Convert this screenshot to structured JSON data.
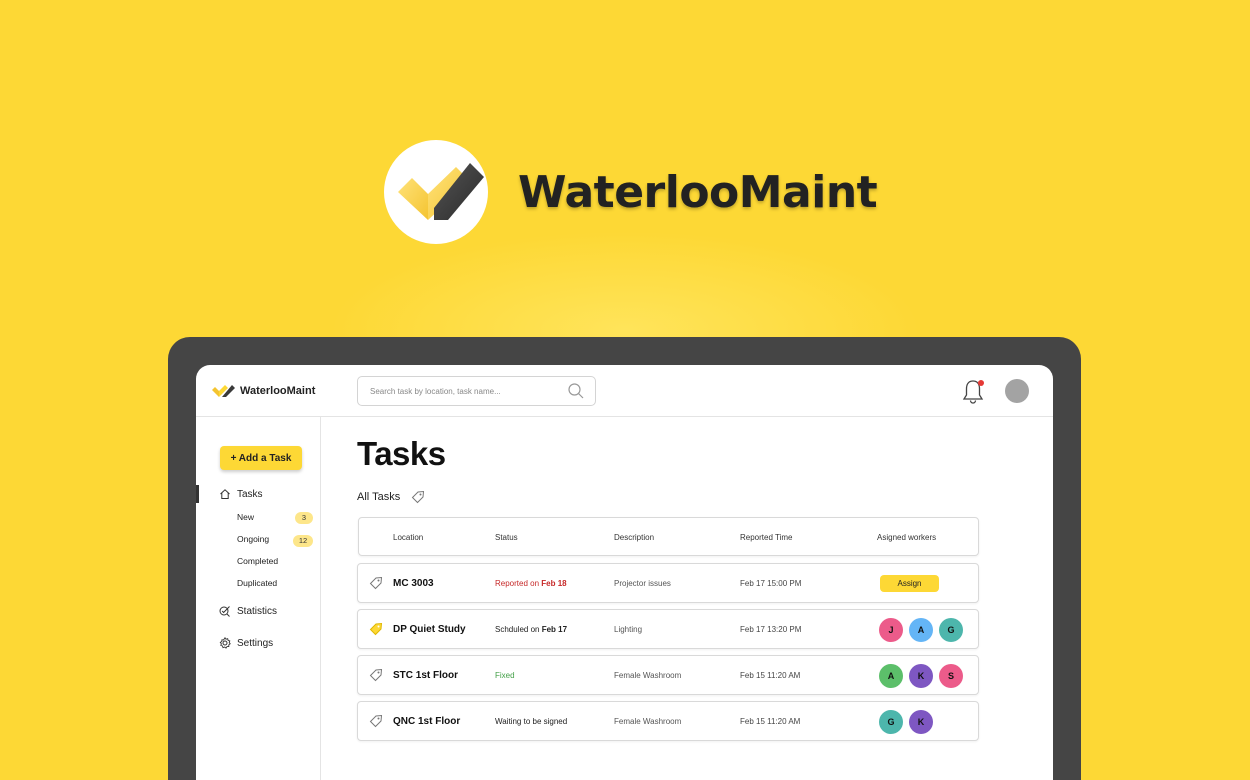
{
  "hero": {
    "title": "WaterlooMaint"
  },
  "app": {
    "brand": "WaterlooMaint",
    "search": {
      "placeholder": "Search task by location, task name...",
      "value": ""
    },
    "notification_dot_color": "#E53935"
  },
  "sidebar": {
    "add_task_label": "+ Add a Task",
    "tasks_label": "Tasks",
    "sub_items": [
      {
        "label": "New",
        "count": "3"
      },
      {
        "label": "Ongoing",
        "count": "12"
      },
      {
        "label": "Completed"
      },
      {
        "label": "Duplicated"
      }
    ],
    "statistics_label": "Statistics",
    "settings_label": "Settings"
  },
  "main": {
    "title": "Tasks",
    "filter_label": "All Tasks",
    "columns": [
      "Location",
      "Status",
      "Description",
      "Reported Time",
      "Asigned workers"
    ],
    "rows": [
      {
        "location": "MC 3003",
        "status_prefix": "Reported on ",
        "status_date": "Feb 18",
        "status_color": "#C62828",
        "description": "Projector issues",
        "time": "Feb 17 15:00 PM",
        "tag_filled": false,
        "assign_label": "Assign",
        "workers": []
      },
      {
        "location": "DP Quiet Study",
        "status_prefix": "Schduled on ",
        "status_date": "Feb 17",
        "status_color": "#222222",
        "description": "Lighting",
        "time": "Feb 17 13:20 PM",
        "tag_filled": true,
        "workers": [
          {
            "initial": "J",
            "color": "#EC5B8A"
          },
          {
            "initial": "A",
            "color": "#64B5F6"
          },
          {
            "initial": "G",
            "color": "#4DB6AC"
          }
        ]
      },
      {
        "location": "STC 1st Floor",
        "status_prefix": "Fixed",
        "status_date": "",
        "status_color": "#43A047",
        "description": "Female Washroom",
        "time": "Feb 15 11:20 AM",
        "tag_filled": false,
        "workers": [
          {
            "initial": "A",
            "color": "#5CBF6A"
          },
          {
            "initial": "K",
            "color": "#7E57C2"
          },
          {
            "initial": "S",
            "color": "#EC5B8A"
          }
        ]
      },
      {
        "location": "QNC 1st Floor",
        "status_prefix": "Waiting to be signed",
        "status_date": "",
        "status_color": "#222222",
        "description": "Female Washroom",
        "time": "Feb 15 11:20 AM",
        "tag_filled": false,
        "workers": [
          {
            "initial": "G",
            "color": "#4DB6AC"
          },
          {
            "initial": "K",
            "color": "#7E57C2"
          }
        ]
      }
    ]
  },
  "colors": {
    "accent": "#FDD835",
    "frame": "#454545",
    "badge": "#FDE68A"
  }
}
